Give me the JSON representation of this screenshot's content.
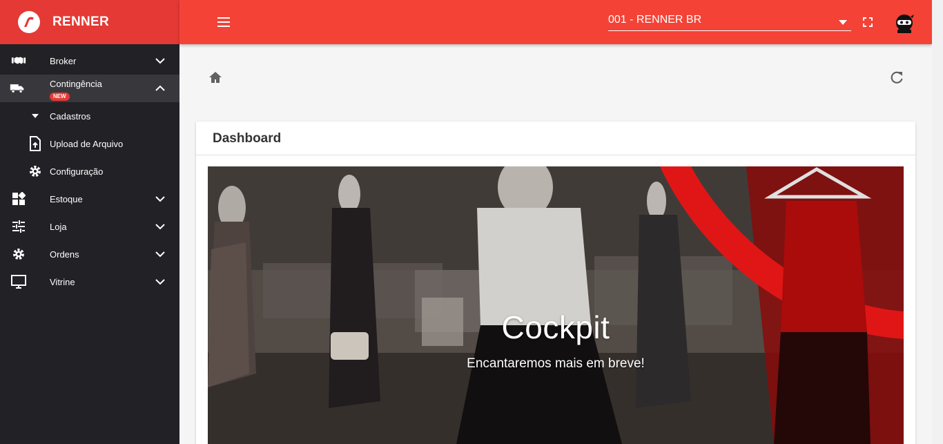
{
  "app": {
    "brand": "RENNER",
    "logo_icon": "renner-r-logo-icon"
  },
  "colors": {
    "brand_red": "#e53935",
    "topbar_red": "#f44336",
    "sidebar_bg": "#222226",
    "sidebar_active": "#38383c"
  },
  "sidebar": {
    "items": [
      {
        "label": "Broker",
        "icon": "handshake-icon",
        "expanded": false
      },
      {
        "label": "Contingência",
        "icon": "truck-icon",
        "badge": "NEW",
        "expanded": true
      },
      {
        "label": "Cadastros",
        "icon": "caret-down-icon",
        "sub": true
      },
      {
        "label": "Upload de Arquivo",
        "icon": "file-upload-icon",
        "sub": true
      },
      {
        "label": "Configuração",
        "icon": "gear-icon",
        "sub": true
      },
      {
        "label": "Estoque",
        "icon": "dashboard-icon",
        "expanded": false
      },
      {
        "label": "Loja",
        "icon": "sliders-icon",
        "expanded": false
      },
      {
        "label": "Ordens",
        "icon": "gear-icon",
        "expanded": false
      },
      {
        "label": "Vitrine",
        "icon": "monitor-icon",
        "expanded": false
      }
    ]
  },
  "topbar": {
    "menu_icon": "hamburger-menu-icon",
    "store_selected": "001 - RENNER BR",
    "fullscreen_icon": "fullscreen-icon",
    "avatar_icon": "ninja-avatar-icon"
  },
  "breadcrumb": {
    "home_icon": "home-icon",
    "refresh_icon": "refresh-icon"
  },
  "card": {
    "title": "Dashboard",
    "banner_title": "Cockpit",
    "banner_subtitle": "Encantaremos mais em breve!"
  }
}
